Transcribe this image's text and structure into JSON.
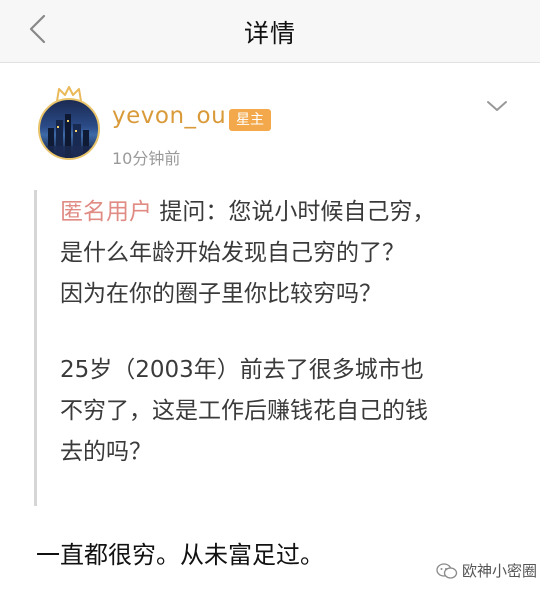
{
  "header": {
    "title": "详情",
    "back_icon": "chevron-left-icon"
  },
  "post": {
    "username": "yevon_ou",
    "badge": "星主",
    "timestamp": "10分钟前",
    "menu_icon": "chevron-down-icon",
    "question": {
      "asker": "匿名用户",
      "prefix": "提问：",
      "line1": "您说小时候自己穷，",
      "line2": "是什么年龄开始发现自己穷的了？",
      "line3": "因为在你的圈子里你比较穷吗？",
      "line4": "25岁（2003年）前去了很多城市也",
      "line5": "不穷了，这是工作后赚钱花自己的钱",
      "line6": "去的吗？"
    },
    "answer": "一直都很穷。从未富足过。"
  },
  "footer": {
    "brand": "欧神小密圈",
    "brand_icon": "wechat-icon"
  },
  "colors": {
    "username": "#d99a3a",
    "badge": "#f2a84b",
    "anon": "#e08b84"
  }
}
